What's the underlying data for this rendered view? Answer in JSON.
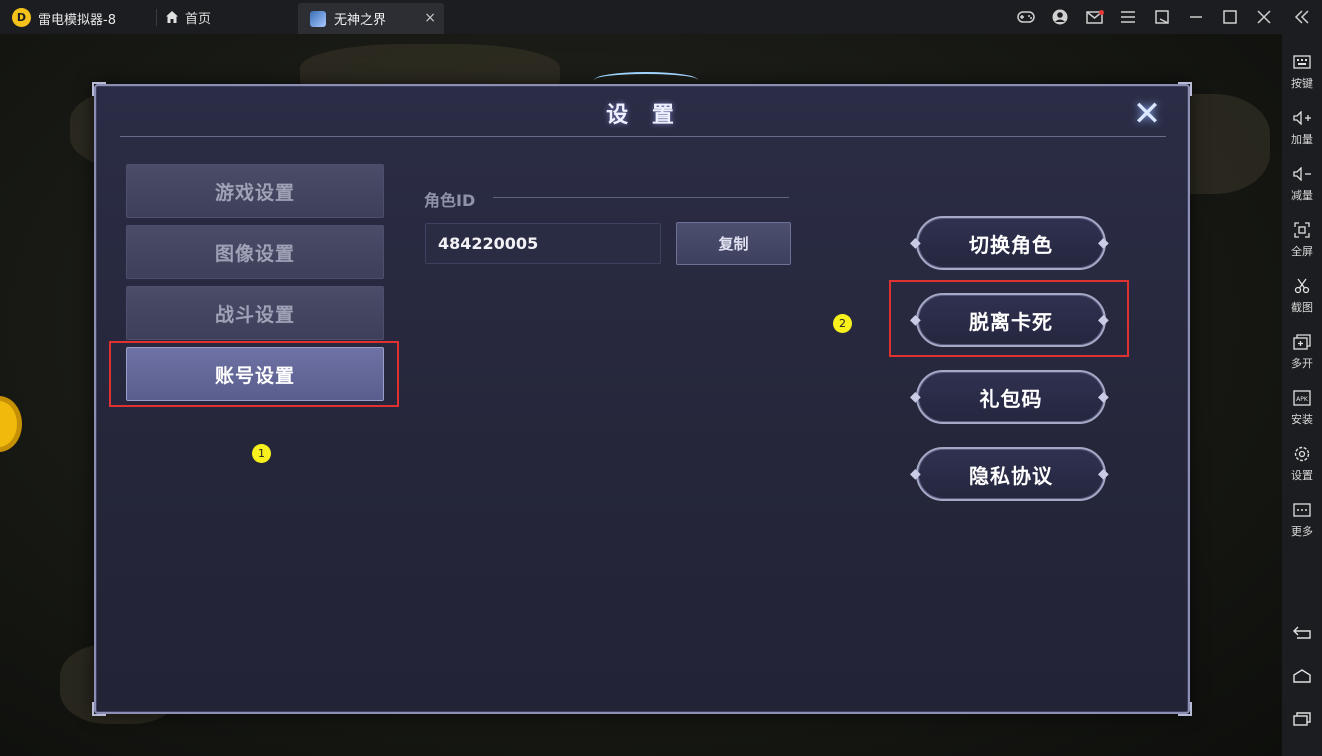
{
  "window": {
    "app_title": "雷电模拟器-8",
    "home_tab": "首页",
    "game_tab": "无神之界",
    "close_tab_glyph": "×",
    "controls": [
      "gamepad-icon",
      "user-icon",
      "mail-icon",
      "menu-icon",
      "popout-icon",
      "minimize-icon",
      "maximize-icon",
      "close-icon",
      "collapse-icon"
    ]
  },
  "sidebar": {
    "items": [
      {
        "label": "按键",
        "icon": "keyboard-icon"
      },
      {
        "label": "加量",
        "icon": "volume-up-icon"
      },
      {
        "label": "减量",
        "icon": "volume-down-icon"
      },
      {
        "label": "全屏",
        "icon": "fullscreen-icon"
      },
      {
        "label": "截图",
        "icon": "scissors-icon"
      },
      {
        "label": "多开",
        "icon": "multi-instance-icon"
      },
      {
        "label": "安装",
        "icon": "apk-install-icon"
      },
      {
        "label": "设置",
        "icon": "settings-gear-icon"
      },
      {
        "label": "更多",
        "icon": "more-icon"
      }
    ],
    "bottom_icons": [
      "back-icon",
      "home-icon",
      "recent-apps-icon"
    ]
  },
  "dialog": {
    "title": "设 置",
    "nav": [
      {
        "label": "游戏设置",
        "active": false
      },
      {
        "label": "图像设置",
        "active": false
      },
      {
        "label": "战斗设置",
        "active": false
      },
      {
        "label": "账号设置",
        "active": true
      }
    ],
    "role_id_label": "角色ID",
    "role_id_value": "484220005",
    "copy_label": "复制",
    "actions": [
      "切换角色",
      "脱离卡死",
      "礼包码",
      "隐私协议"
    ]
  },
  "annotations": {
    "marker_1": "1",
    "marker_2": "2",
    "color": "#e03131"
  }
}
